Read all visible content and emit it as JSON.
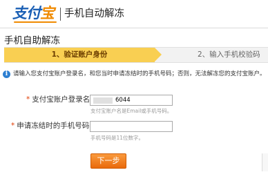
{
  "header": {
    "logo_text_main": "支付",
    "logo_text_accent": "宝",
    "title": "手机自动解冻"
  },
  "section": {
    "title": "手机自助解冻"
  },
  "steps": [
    {
      "label": "1、验证账户身份",
      "active": true
    },
    {
      "label": "2、输入手机校验码",
      "active": false
    }
  ],
  "info": {
    "icon": "info-icon",
    "text": "请输入您支付宝账户登录名，和您当时申请冻结时的手机号码；否则，无法解冻您的支付宝账户。"
  },
  "form": {
    "account": {
      "required_mark": "*",
      "label": "支付宝账户登录名：",
      "value_suffix": "6044",
      "hint": "支付宝账户名是Email或手机号码。"
    },
    "phone": {
      "required_mark": "*",
      "label": "申请冻结时的手机号码：",
      "value": "",
      "hint": "手机号码是11位数字。"
    },
    "submit_label": "下一步"
  },
  "colors": {
    "brand_blue": "#1a5fb4",
    "brand_orange": "#f08a00",
    "step_active": "#f9cf52",
    "button": "#f07c1c",
    "required": "#e03a00"
  }
}
